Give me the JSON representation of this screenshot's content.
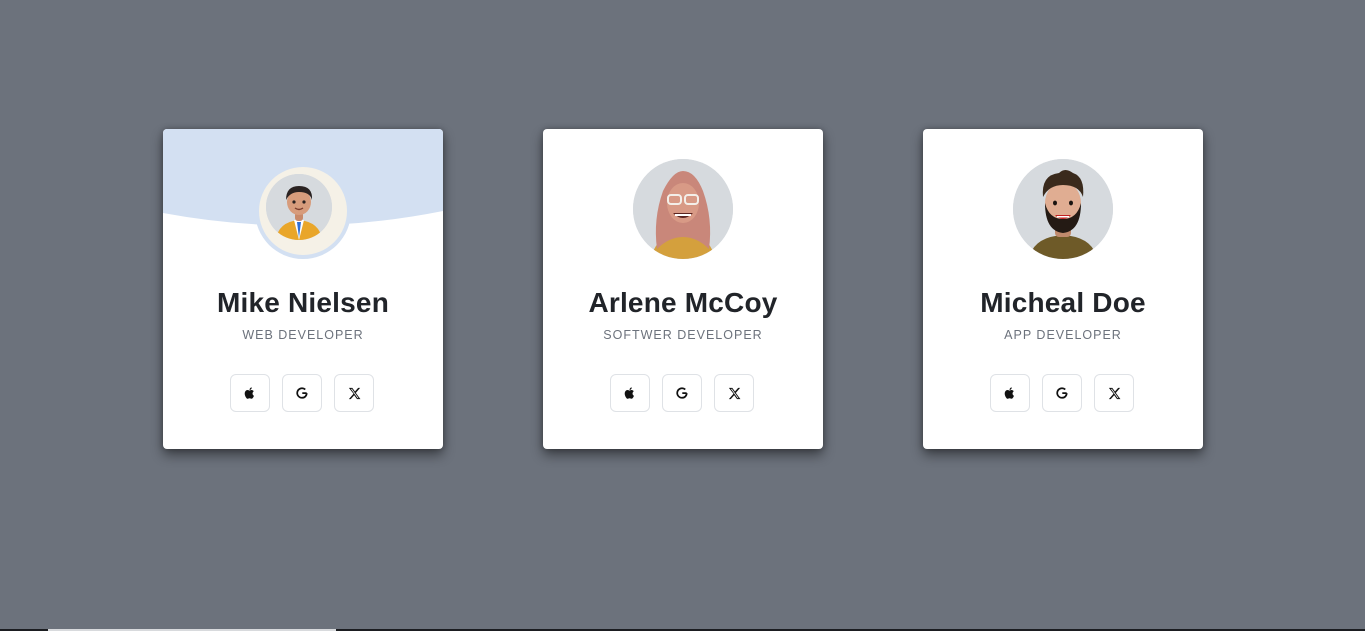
{
  "colors": {
    "page_background": "#6c727c",
    "card_background": "#ffffff",
    "card_header_accent": "#d3e0f2",
    "name_text": "#212429",
    "role_text": "#6c727c",
    "button_border": "#dfe2e6"
  },
  "cards": [
    {
      "name": "Mike Nielsen",
      "role": "WEB DEVELOPER",
      "avatar_icon": "avatar-man-suit-icon",
      "has_header_curve": true,
      "socials": [
        {
          "icon": "apple-icon"
        },
        {
          "icon": "google-icon"
        },
        {
          "icon": "x-icon"
        }
      ]
    },
    {
      "name": "Arlene McCoy",
      "role": "SOFTWER DEVELOPER",
      "avatar_icon": "avatar-woman-hijab-icon",
      "has_header_curve": false,
      "socials": [
        {
          "icon": "apple-icon"
        },
        {
          "icon": "google-icon"
        },
        {
          "icon": "x-icon"
        }
      ]
    },
    {
      "name": "Micheal Doe",
      "role": "APP DEVELOPER",
      "avatar_icon": "avatar-man-beard-icon",
      "has_header_curve": false,
      "socials": [
        {
          "icon": "apple-icon"
        },
        {
          "icon": "google-icon"
        },
        {
          "icon": "x-icon"
        }
      ]
    }
  ]
}
